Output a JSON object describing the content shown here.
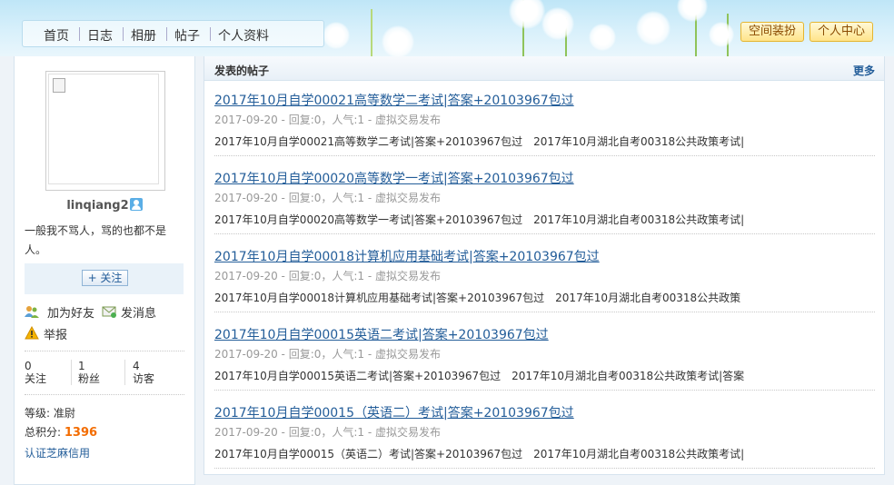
{
  "nav": {
    "items": [
      "首页",
      "日志",
      "相册",
      "帖子",
      "个人资料"
    ],
    "space_decorate": "空间装扮",
    "personal_center": "个人中心"
  },
  "profile": {
    "username": "linqiang2",
    "bio": "一般我不骂人，骂的也都不是人。",
    "follow_label": "+ 关注",
    "add_friend": "加为好友",
    "send_message": "发消息",
    "report": "举报",
    "stats": [
      {
        "value": "0",
        "label": "关注"
      },
      {
        "value": "1",
        "label": "粉丝"
      },
      {
        "value": "4",
        "label": "访客"
      }
    ],
    "level_label": "等级:",
    "level_value": "准尉",
    "points_label": "总积分:",
    "points_value": "1396",
    "certify": "认证芝麻信用"
  },
  "posts_panel": {
    "title": "发表的帖子",
    "more": "更多",
    "posts": [
      {
        "title": "2017年10月自学00021高等数学二考试|答案+20103967包过",
        "meta": "2017-09-20 - 回复:0，人气:1 - 虚拟交易发布",
        "excerpt": "2017年10月自学00021高等数学二考试|答案+20103967包过　2017年10月湖北自考00318公共政策考试|"
      },
      {
        "title": "2017年10月自学00020高等数学一考试|答案+20103967包过",
        "meta": "2017-09-20 - 回复:0，人气:1 - 虚拟交易发布",
        "excerpt": "2017年10月自学00020高等数学一考试|答案+20103967包过　2017年10月湖北自考00318公共政策考试|"
      },
      {
        "title": "2017年10月自学00018计算机应用基础考试|答案+20103967包过",
        "meta": "2017-09-20 - 回复:0，人气:1 - 虚拟交易发布",
        "excerpt": "2017年10月自学00018计算机应用基础考试|答案+20103967包过　2017年10月湖北自考00318公共政策"
      },
      {
        "title": "2017年10月自学00015英语二考试|答案+20103967包过",
        "meta": "2017-09-20 - 回复:0，人气:1 - 虚拟交易发布",
        "excerpt": "2017年10月自学00015英语二考试|答案+20103967包过　2017年10月湖北自考00318公共政策考试|答案"
      },
      {
        "title": "2017年10月自学00015（英语二）考试|答案+20103967包过",
        "meta": "2017-09-20 - 回复:0，人气:1 - 虚拟交易发布",
        "excerpt": "2017年10月自学00015（英语二）考试|答案+20103967包过　2017年10月湖北自考00318公共政策考试|"
      }
    ]
  }
}
